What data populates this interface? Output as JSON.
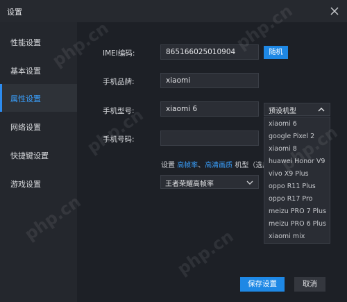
{
  "window": {
    "title": "设置"
  },
  "sidebar": {
    "items": [
      {
        "label": "性能设置",
        "active": false
      },
      {
        "label": "基本设置",
        "active": false
      },
      {
        "label": "属性设置",
        "active": true
      },
      {
        "label": "网络设置",
        "active": false
      },
      {
        "label": "快捷键设置",
        "active": false
      },
      {
        "label": "游戏设置",
        "active": false
      }
    ]
  },
  "form": {
    "imei": {
      "label": "IMEI编码:",
      "value": "865166025010904",
      "random_button": "随机"
    },
    "brand": {
      "label": "手机品牌:",
      "value": "xiaomi"
    },
    "model": {
      "label": "手机型号:",
      "value": "xiaomi 6",
      "preset_select": "预设机型",
      "options": [
        "xiaomi 6",
        "google Pixel 2",
        "xiaomi 8",
        "huawei Honor V9",
        "vivo X9 Plus",
        "oppo R11 Plus",
        "oppo R17 Pro",
        "meizu PRO 7 Plus",
        "meizu PRO 6 Plus",
        "xiaomi mix"
      ]
    },
    "phone": {
      "label": "手机号码:",
      "value": ""
    },
    "note": {
      "prefix": "设置 ",
      "link1": "高帧率",
      "sep": "、",
      "link2": "高清画质",
      "suffix": " 机型（选用影"
    },
    "fps_select": {
      "value": "王者荣耀高帧率"
    }
  },
  "footer": {
    "save": "保存设置",
    "cancel": "取消"
  },
  "watermark": "php.cn",
  "colors": {
    "accent": "#1e88e5",
    "active_text": "#3aa1ff",
    "bg": "#1d2026",
    "sidebar": "#24272d"
  }
}
